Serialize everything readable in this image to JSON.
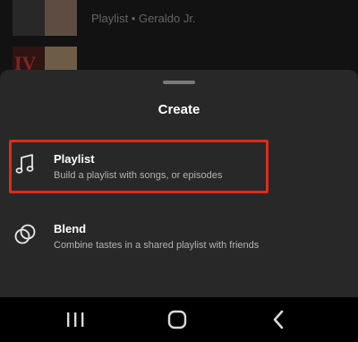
{
  "background": {
    "rows": [
      {
        "subtitle": "Playlist • Geraldo Jr."
      },
      {
        "overlay_text": "IV"
      }
    ]
  },
  "sheet": {
    "title": "Create",
    "options": [
      {
        "title": "Playlist",
        "subtitle": "Build a playlist with songs, or episodes",
        "icon": "music-note-icon",
        "highlighted": true
      },
      {
        "title": "Blend",
        "subtitle": "Combine tastes in a shared playlist with friends",
        "icon": "blend-circles-icon",
        "highlighted": false
      }
    ]
  },
  "colors": {
    "highlight": "#e02a1d",
    "sheet_bg": "#282828",
    "text_primary": "#ffffff",
    "text_secondary": "#b3b3b3"
  },
  "navbar": {
    "buttons": [
      "recents-icon",
      "home-icon",
      "back-icon"
    ]
  }
}
